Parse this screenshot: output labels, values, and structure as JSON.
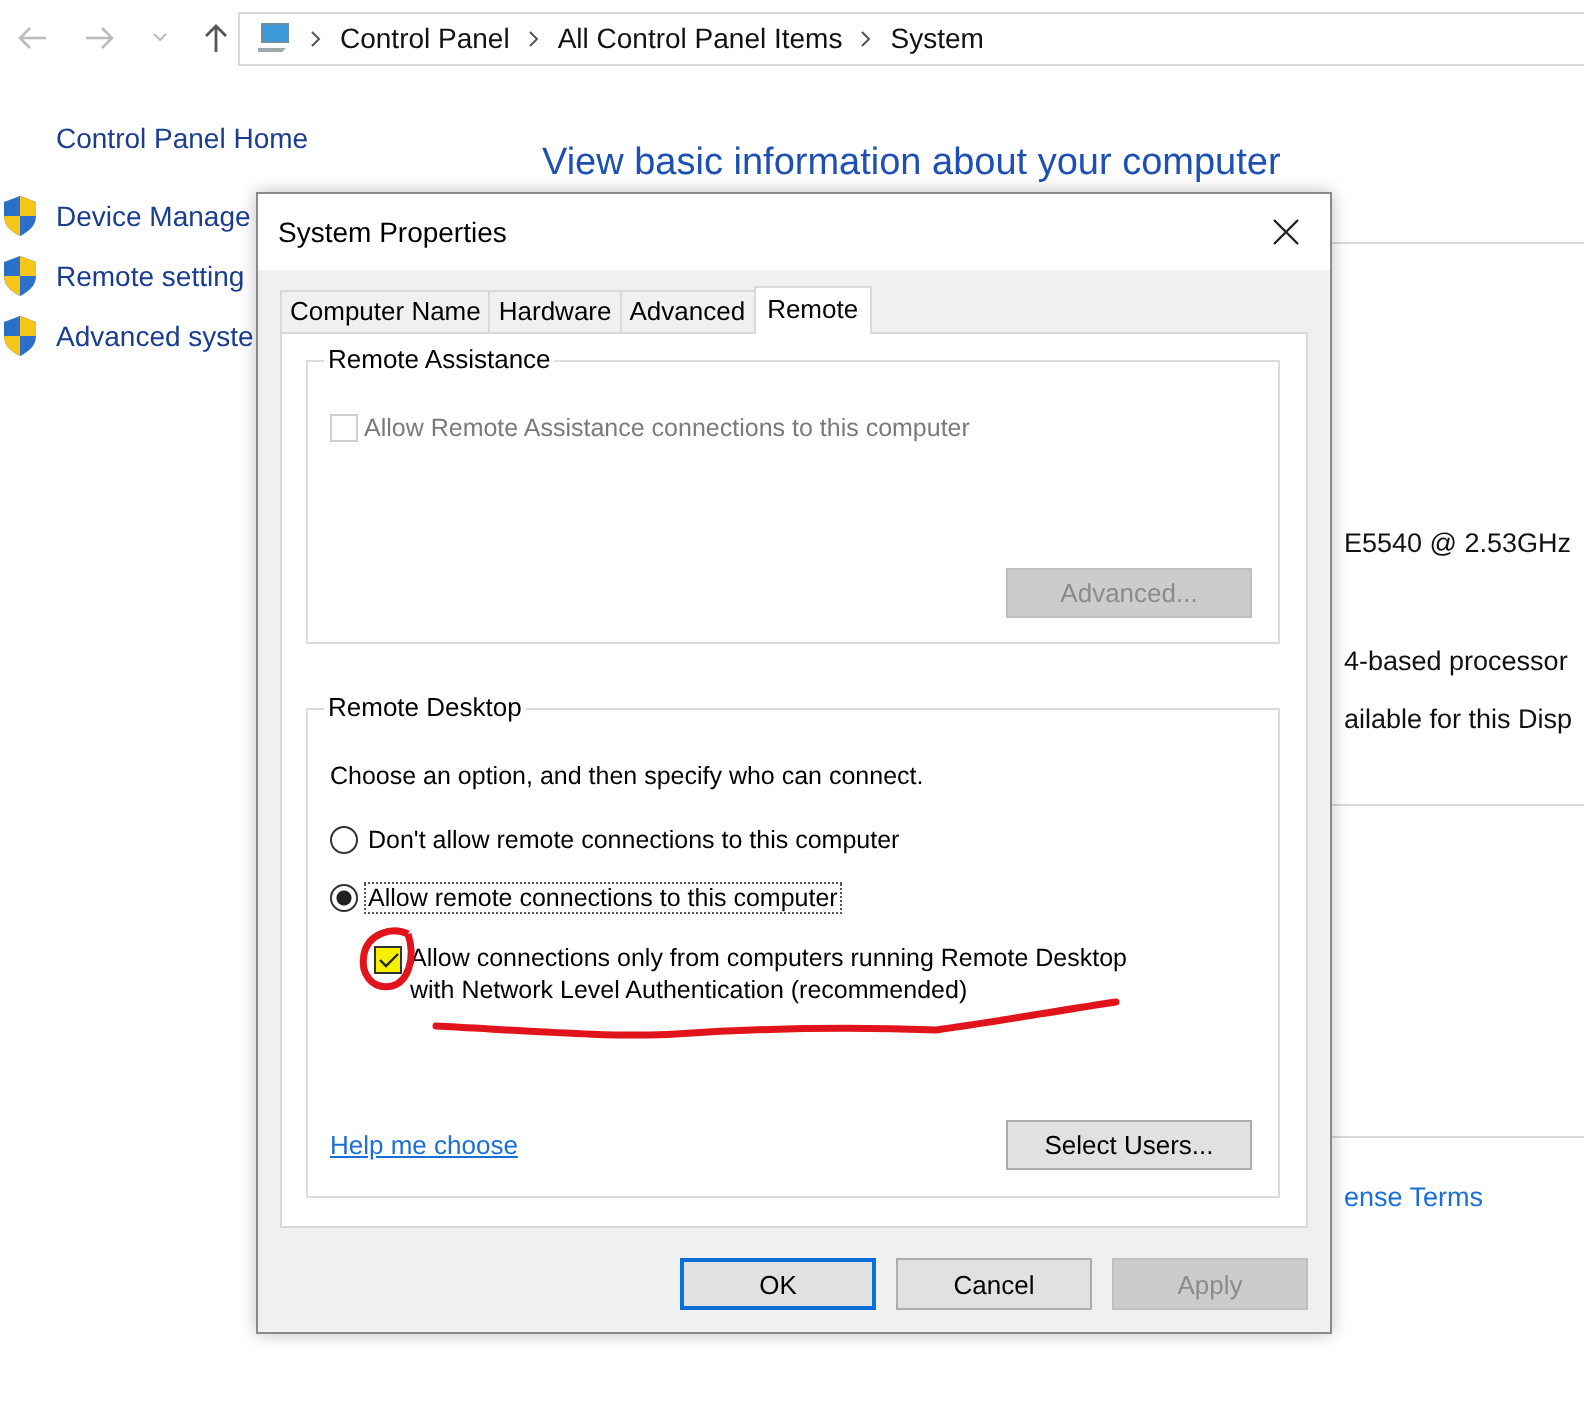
{
  "address_bar": {
    "crumbs": [
      "Control Panel",
      "All Control Panel Items",
      "System"
    ]
  },
  "sidebar": {
    "home": "Control Panel Home",
    "items": [
      "Device Manage",
      "Remote setting",
      "Advanced syste"
    ]
  },
  "heading": "View basic information about your computer",
  "details": [
    "E5540  @ 2.53GHz",
    "4-based processor",
    "ailable for this Disp"
  ],
  "license_link": "ense Terms",
  "dialog": {
    "title": "System Properties",
    "tabs": [
      {
        "label": "Computer Name",
        "selected": false
      },
      {
        "label": "Hardware",
        "selected": false
      },
      {
        "label": "Advanced",
        "selected": false
      },
      {
        "label": "Remote",
        "selected": true
      }
    ],
    "remote_assistance": {
      "title": "Remote Assistance",
      "checkbox": {
        "label": "Allow Remote Assistance connections to this computer",
        "checked": false,
        "disabled": true
      },
      "button": {
        "label": "Advanced...",
        "disabled": true
      }
    },
    "remote_desktop": {
      "title": "Remote Desktop",
      "instruction": "Choose an option, and then specify who can connect.",
      "options": [
        {
          "label": "Don't allow remote connections to this computer",
          "selected": false
        },
        {
          "label": "Allow remote connections to this computer",
          "selected": true
        }
      ],
      "nla": {
        "label_lines": [
          "Allow connections only from computers running Remote Desktop",
          "with Network Level Authentication (recommended)"
        ],
        "checked": true
      },
      "help_link": "Help me choose",
      "button": {
        "label": "Select Users...",
        "disabled": false
      }
    },
    "buttons": [
      {
        "label": "OK",
        "default": true,
        "disabled": false
      },
      {
        "label": "Cancel",
        "default": false,
        "disabled": false
      },
      {
        "label": "Apply",
        "default": false,
        "disabled": true
      }
    ]
  }
}
